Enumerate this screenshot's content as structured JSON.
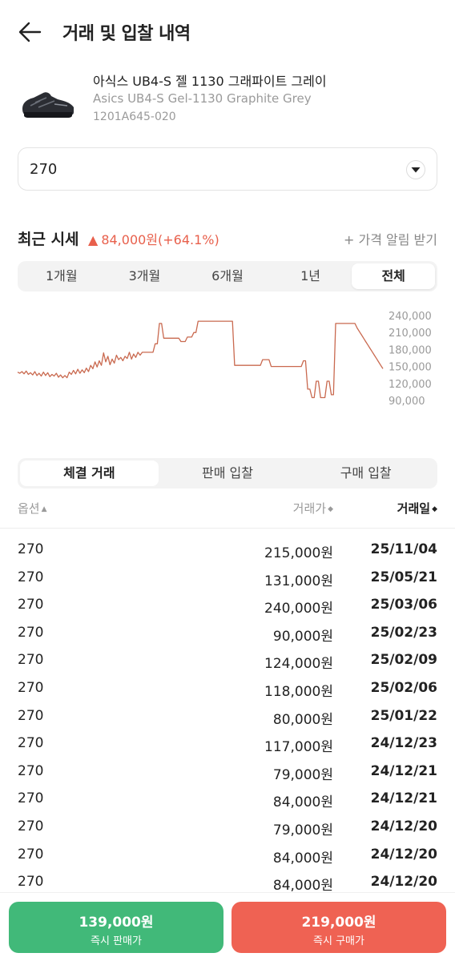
{
  "header": {
    "title": "거래 및 입찰 내역",
    "back_icon": "arrow-left-icon"
  },
  "product": {
    "name_ko": "아식스 UB4-S 젤 1130 그래파이트 그레이",
    "name_en": "Asics UB4-S Gel-1130 Graphite Grey",
    "code": "1201A645-020"
  },
  "size_select": {
    "value": "270",
    "icon": "chevron-down-icon"
  },
  "recent_price": {
    "title": "최근 시세",
    "arrow": "▲",
    "change": "84,000원(+64.1%)",
    "alert": "+ 가격 알림 받기",
    "up_color": "#e8604c"
  },
  "period_tabs": [
    "1개월",
    "3개월",
    "6개월",
    "1년",
    "전체"
  ],
  "period_active": "전체",
  "chart_data": {
    "type": "line",
    "color": "#c9694f",
    "y_ticks": [
      "240,000",
      "210,000",
      "180,000",
      "150,000",
      "120,000",
      "90,000"
    ],
    "ylim": [
      90000,
      240000
    ],
    "values": [
      140000,
      138000,
      141000,
      137000,
      142000,
      136000,
      139000,
      135000,
      141000,
      134000,
      138000,
      133000,
      140000,
      134000,
      139000,
      132000,
      136000,
      133000,
      138000,
      131000,
      135000,
      130000,
      134000,
      130000,
      140000,
      136000,
      143000,
      137000,
      145000,
      138000,
      144000,
      139000,
      147000,
      141000,
      152000,
      146000,
      158000,
      149000,
      160000,
      152000,
      174000,
      158000,
      168000,
      153000,
      163000,
      156000,
      170000,
      162000,
      166000,
      160000,
      168000,
      164000,
      175000,
      163000,
      172000,
      166000,
      175000,
      170000,
      175000,
      175000,
      175000,
      175000,
      175000,
      175000,
      190000,
      190000,
      226000,
      226000,
      200000,
      200000,
      200000,
      200000,
      200000,
      200000,
      200000,
      200000,
      194000,
      194000,
      194000,
      202000,
      202000,
      202000,
      210000,
      210000,
      230000,
      230000,
      230000,
      230000,
      230000,
      230000,
      230000,
      230000,
      230000,
      230000,
      230000,
      230000,
      230000,
      230000,
      230000,
      230000,
      230000,
      152000,
      152000,
      152000,
      152000,
      152000,
      152000,
      152000,
      152000,
      152000,
      152000,
      152000,
      152000,
      152000,
      162000,
      162000,
      162000,
      162000,
      150000,
      150000,
      150000,
      150000,
      150000,
      150000,
      150000,
      150000,
      150000,
      150000,
      150000,
      150000,
      150000,
      150000,
      150000,
      160000,
      160000,
      110000,
      110000,
      95000,
      95000,
      124000,
      124000,
      95000,
      95000,
      95000,
      124000,
      124000,
      100000,
      100000,
      226000,
      226000,
      226000,
      226000,
      226000,
      226000,
      226000,
      226000,
      226000,
      226000,
      218000,
      212000,
      206000,
      200000,
      194000,
      188000,
      182000,
      176000,
      170000,
      164000,
      158000,
      152000,
      146000
    ]
  },
  "trade_tabs": [
    "체결 거래",
    "판매 입찰",
    "구매 입찰"
  ],
  "trade_active": "체결 거래",
  "table": {
    "col_option": "옵션",
    "col_price": "거래가",
    "col_date": "거래일",
    "sort_icon": "sort-icon",
    "rows": [
      {
        "option": "270",
        "price": "215,000원",
        "date": "25/11/04"
      },
      {
        "option": "270",
        "price": "131,000원",
        "date": "25/05/21"
      },
      {
        "option": "270",
        "price": "240,000원",
        "date": "25/03/06"
      },
      {
        "option": "270",
        "price": "90,000원",
        "date": "25/02/23"
      },
      {
        "option": "270",
        "price": "124,000원",
        "date": "25/02/09"
      },
      {
        "option": "270",
        "price": "118,000원",
        "date": "25/02/06"
      },
      {
        "option": "270",
        "price": "80,000원",
        "date": "25/01/22"
      },
      {
        "option": "270",
        "price": "117,000원",
        "date": "24/12/23"
      },
      {
        "option": "270",
        "price": "79,000원",
        "date": "24/12/21"
      },
      {
        "option": "270",
        "price": "84,000원",
        "date": "24/12/21"
      },
      {
        "option": "270",
        "price": "79,000원",
        "date": "24/12/20"
      },
      {
        "option": "270",
        "price": "84,000원",
        "date": "24/12/20"
      },
      {
        "option": "270",
        "price": "84,000원",
        "date": "24/12/20"
      }
    ]
  },
  "bottom": {
    "sell_price": "139,000원",
    "sell_label": "즉시 판매가",
    "buy_price": "219,000원",
    "buy_label": "즉시 구매가",
    "sell_color": "#41b979",
    "buy_color": "#ef6253"
  }
}
